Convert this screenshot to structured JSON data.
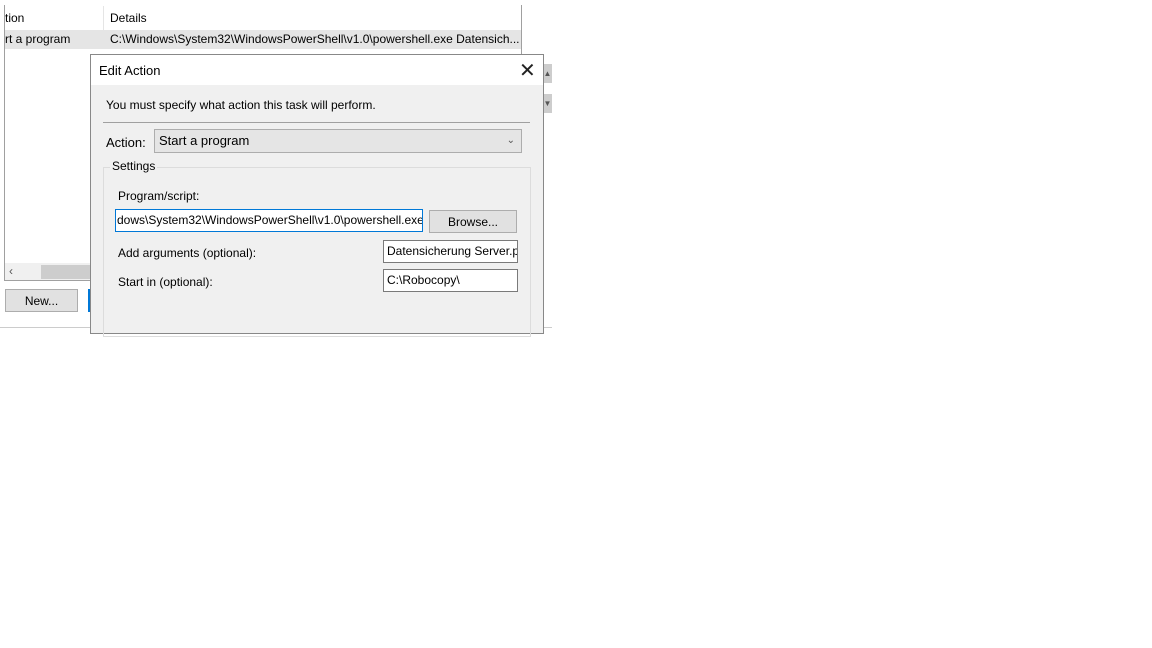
{
  "list": {
    "columns": [
      "tion",
      "Details"
    ],
    "rows": [
      {
        "action": "rt a program",
        "details": "C:\\Windows\\System32\\WindowsPowerShell\\v1.0\\powershell.exe Datensich..."
      }
    ]
  },
  "new_button": "New...",
  "dialog": {
    "title": "Edit Action",
    "instruction": "You must specify what action this task will perform.",
    "action_label": "Action:",
    "action_value": "Start a program",
    "settings_label": "Settings",
    "program_label": "Program/script:",
    "program_value": "dows\\System32\\WindowsPowerShell\\v1.0\\powershell.exe",
    "browse": "Browse...",
    "args_label": "Add arguments (optional):",
    "args_value": "Datensicherung Server.p",
    "startin_label": "Start in (optional):",
    "startin_value": "C:\\Robocopy\\"
  },
  "colors": {
    "focus": "#0078d7",
    "selected_row": "#e5e5e5"
  }
}
